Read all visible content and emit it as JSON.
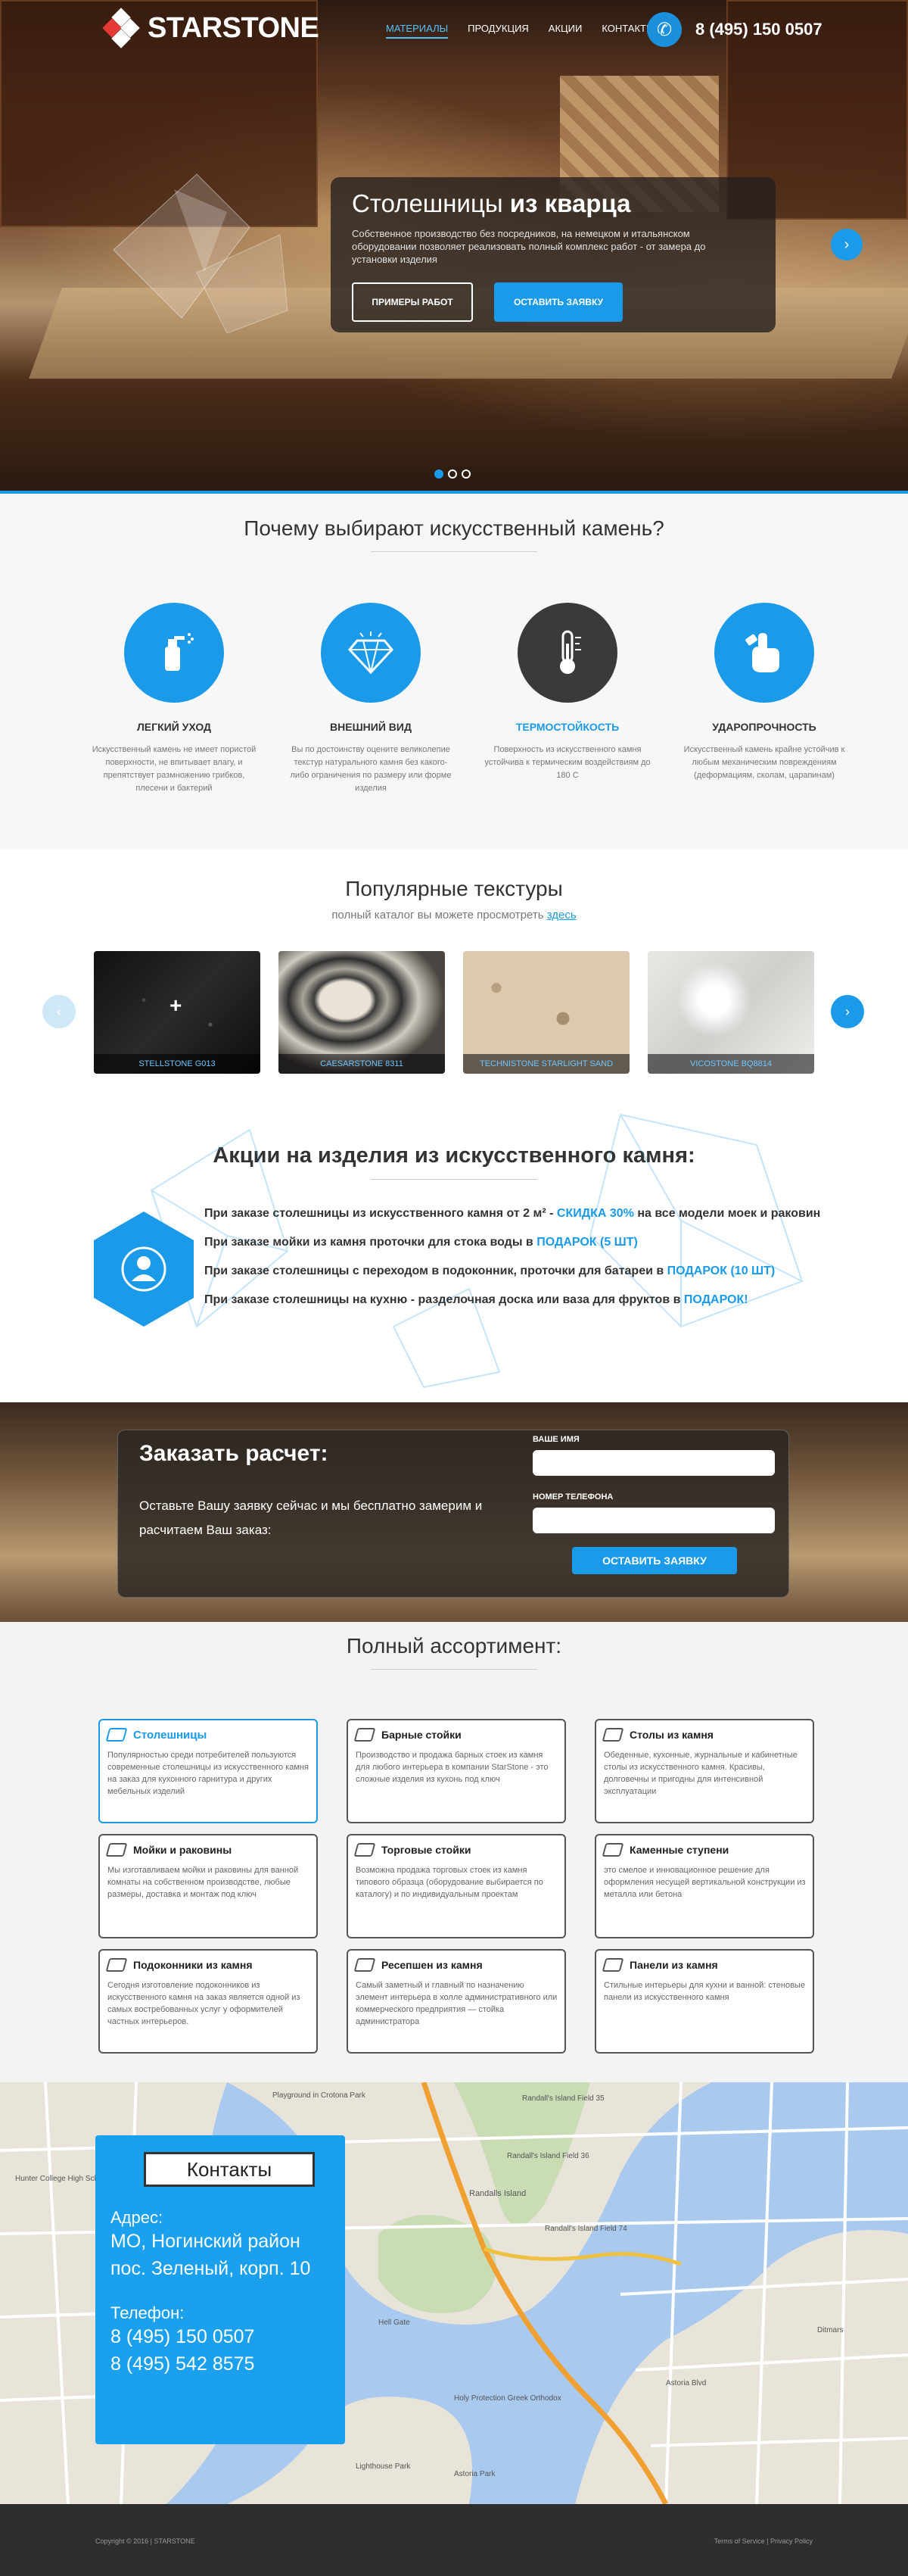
{
  "header": {
    "logo_text": "STARSTONE",
    "nav": [
      "МАТЕРИАЛЫ",
      "ПРОДУКЦИЯ",
      "АКЦИИ",
      "КОНТАКТЫ"
    ],
    "active_nav": "МАТЕРИАЛЫ",
    "phone": "8 (495) 150 0507"
  },
  "hero": {
    "title_light": "Столешницы",
    "title_bold": "из кварца",
    "description": "Собственное производство без посредников, на немецком и итальянском оборудовании позволяет реализовать полный комплекс работ - от замера до установки изделия",
    "btn_examples": "ПРИМЕРЫ РАБОТ",
    "btn_order": "ОСТАВИТЬ ЗАЯВКУ",
    "slider_active": 1,
    "slider_count": 3
  },
  "why": {
    "title": "Почему выбирают искусственный камень?",
    "features": [
      {
        "icon": "spray-bottle-icon",
        "title": "ЛЕГКИЙ УХОД",
        "text": "Искусственный камень не имеет пористой поверхности, не впитывает влагу, и препятствует размножению грибков, плесени и бактерий"
      },
      {
        "icon": "diamond-icon",
        "title": "ВНЕШНИЙ ВИД",
        "text": "Вы по достоинству оцените великолепие текстур натурального камня без какого-либо ограничения по размеру или форме изделия"
      },
      {
        "icon": "thermometer-icon",
        "title": "ТЕРМОСТОЙКОСТЬ",
        "text": "Поверхность из искусственного камня устойчива к термическим воздействиям до 180 С"
      },
      {
        "icon": "hand-icon",
        "title": "УДАРОПРОЧНОСТЬ",
        "text": "Искусственный камень крайне устойчив к любым механическим повреждениям (деформациям, сколам, царапинам)"
      }
    ]
  },
  "textures": {
    "title": "Популярные текстуры",
    "subtitle": "полный каталог вы можете просмотреть",
    "link": "здесь",
    "items": [
      {
        "name": "STELLSTONE G013"
      },
      {
        "name": "CAESARSTONE 8311"
      },
      {
        "name": "TECHNISTONE STARLIGHT SAND"
      },
      {
        "name": "VICOSTONE BQ8814"
      }
    ]
  },
  "promo": {
    "title": "Акции на изделия из искусственного камня:",
    "lines": [
      {
        "text": "При заказе столешницы из искусственного камня от 2 м² - ",
        "highlight": "СКИДКА 30%",
        "tail": " на все модели моек и раковин"
      },
      {
        "text": "При заказе мойки из камня проточки для стока воды в ",
        "highlight": "ПОДАРОК (5 ШТ)",
        "tail": ""
      },
      {
        "text": "При заказе столешницы с переходом в подоконник, проточки для батареи в ",
        "highlight": "ПОДАРОК (10 ШТ)",
        "tail": ""
      },
      {
        "text": "При заказе столешницы на кухню - разделочная доска или ваза для фруктов в ",
        "highlight": "ПОДАРОК!",
        "tail": ""
      }
    ]
  },
  "order": {
    "title": "Заказать расчет:",
    "text": "Оставьте Вашу заявку сейчас и мы бесплатно замерим и расчитаем Ваш заказ:",
    "name_label": "ВАШЕ ИМЯ",
    "phone_label": "НОМЕР ТЕЛЕФОНА",
    "button": "ОСТАВИТЬ ЗАЯВКУ"
  },
  "assortment": {
    "title": "Полный ассортимент:",
    "items": [
      {
        "title": "Столешницы",
        "text": "Популярностью среди потребителей пользуются современные столешницы из искусственного камня на заказ для кухонного гарнитура и других мебельных изделий"
      },
      {
        "title": "Барные стойки",
        "text": "Производство и продажа барных стоек из камня для любого интерьера в компании StarStone - это сложные изделия из кухонь под ключ"
      },
      {
        "title": "Столы из камня",
        "text": "Обеденные, кухонные, журнальные и кабинетные столы из искусственного камня. Красивы, долговечны и пригодны для интенсивной эксплуатации"
      },
      {
        "title": "Мойки и раковины",
        "text": "Мы изготавливаем мойки и раковины для ванной комнаты на собственном производстве, любые размеры, доставка и монтаж под ключ"
      },
      {
        "title": "Торговые стойки",
        "text": "Возможна продажа торговых стоек из камня типового образца (оборудование выбирается по каталогу) и по индивидуальным проектам"
      },
      {
        "title": "Каменные ступени",
        "text": "это смелое и инновационное решение для оформления несущей вертикальной конструкции из металла или бетона"
      },
      {
        "title": "Подоконники из камня",
        "text": "Сегодня изготовление подоконников из искусственного камня на заказ является одной из самых востребованных услуг у оформителей частных интерьеров."
      },
      {
        "title": "Ресепшен из камня",
        "text": "Самый заметный и главный по назначению элемент интерьера в холле административного или коммерческого предприятия — стойка администратора"
      },
      {
        "title": "Панели из камня",
        "text": "Стильные интерьеры для кухни и ванной: стеновые панели из искусственного камня"
      }
    ]
  },
  "contacts": {
    "title": "Контакты",
    "address_label": "Адрес:",
    "address_1": "МО, Ногинский район",
    "address_2": "пос. Зеленый, корп. 10",
    "phone_label": "Телефон:",
    "phone_1": "8 (495) 150 0507",
    "phone_2": "8 (495) 542 8575"
  },
  "map_labels": [
    "Randall's Island Field 35",
    "Randall's Island Field 36",
    "Randall's Island Field 74",
    "Playground in Crotona Park",
    "Randalls Island",
    "Hell Gate",
    "Astoria Park",
    "Lighthouse Park",
    "Hunter College High School",
    "Holy Protection Greek Orthodox",
    "Ditmars",
    "Astoria Blvd"
  ],
  "footer": {
    "copyright": "Copyright © 2016 | STARSTONE",
    "links": "Terms of Service | Privacy Policy"
  },
  "colors": {
    "accent": "#1a9ae8",
    "dark": "#2e2e2e"
  }
}
